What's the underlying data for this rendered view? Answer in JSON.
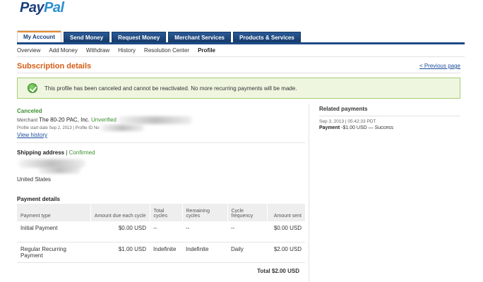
{
  "logo": {
    "pay": "Pay",
    "pal": "Pal"
  },
  "tabs": [
    "My Account",
    "Send Money",
    "Request Money",
    "Merchant Services",
    "Products & Services"
  ],
  "subnav": [
    "Overview",
    "Add Money",
    "Withdraw",
    "History",
    "Resolution Center",
    "Profile"
  ],
  "page_title": "Subscription details",
  "previous_page": "< Previous page",
  "notice": "This profile has been canceled and cannot be reactivated. No more recurring payments will be made.",
  "details": {
    "status": "Canceled",
    "merchant_label": "Merchant",
    "merchant_name": "The 80-20 PAC, Inc.",
    "merchant_status": "Unverified",
    "profile_line": "Profile start date Sep 2, 2013 | Profile ID No",
    "view_history": "View history"
  },
  "shipping": {
    "label": "Shipping address",
    "separator": "|",
    "status": "Confirmed",
    "country": "United States"
  },
  "payment_details": {
    "title": "Payment details",
    "headers": [
      "Payment type",
      "Amount due each cycle",
      "Total cycles",
      "Remaining cycles",
      "Cycle frequency",
      "Amount sent"
    ],
    "rows": [
      [
        "Initial Payment",
        "$0.00 USD",
        "--",
        "--",
        "--",
        "$0.00 USD"
      ],
      [
        "Regular Recurring Payment",
        "$1.00 USD",
        "Indefinite",
        "Indefinite",
        "Daily",
        "$2.00 USD"
      ]
    ],
    "total": "Total $2.00 USD"
  },
  "related": {
    "title": "Related payments",
    "date": "Sep 3, 2013 | 05:42:33 PDT",
    "payment_label": "Payment",
    "payment_detail": "-$1.00 USD — Success"
  },
  "colors": {
    "brand_dark": "#1a3d7e",
    "brand_light": "#2a8fd0",
    "title_orange": "#d45c14",
    "success_green": "#3c8f2f",
    "link_blue": "#1a4b9a"
  }
}
